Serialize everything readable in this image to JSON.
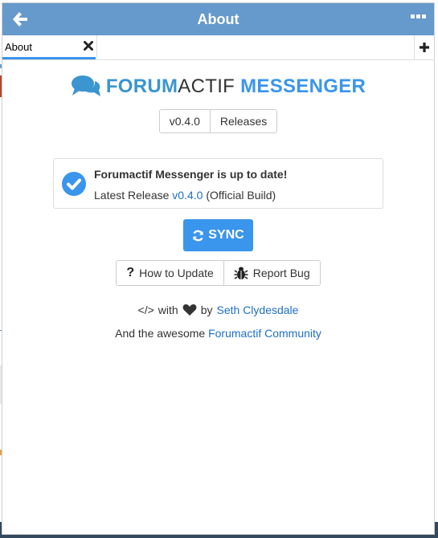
{
  "window": {
    "title": "About",
    "header_color": "#6699cc",
    "accent_color": "#3a95ec"
  },
  "tabs": [
    {
      "label": "About",
      "active": true
    }
  ],
  "logo": {
    "icon": "comments-icon",
    "word1": "FORUM",
    "word2": "ACTIF",
    "word3": "MESSENGER"
  },
  "version_group": {
    "version": "v0.4.0",
    "releases_label": "Releases"
  },
  "status": {
    "icon": "check-circle-icon",
    "title": "Forumactif Messenger is up to date!",
    "latest_prefix": "Latest Release",
    "latest_version": "v0.4.0",
    "build_label": "(Official Build)"
  },
  "sync": {
    "icon": "refresh-icon",
    "label": "SYNC"
  },
  "help": {
    "how_to_update": "How to Update",
    "report_bug": "Report Bug"
  },
  "credits": {
    "code_symbol": "</>",
    "with": "with",
    "by": "by",
    "author": "Seth Clydesdale",
    "line2_prefix": "And the awesome",
    "community": "Forumactif Community"
  }
}
